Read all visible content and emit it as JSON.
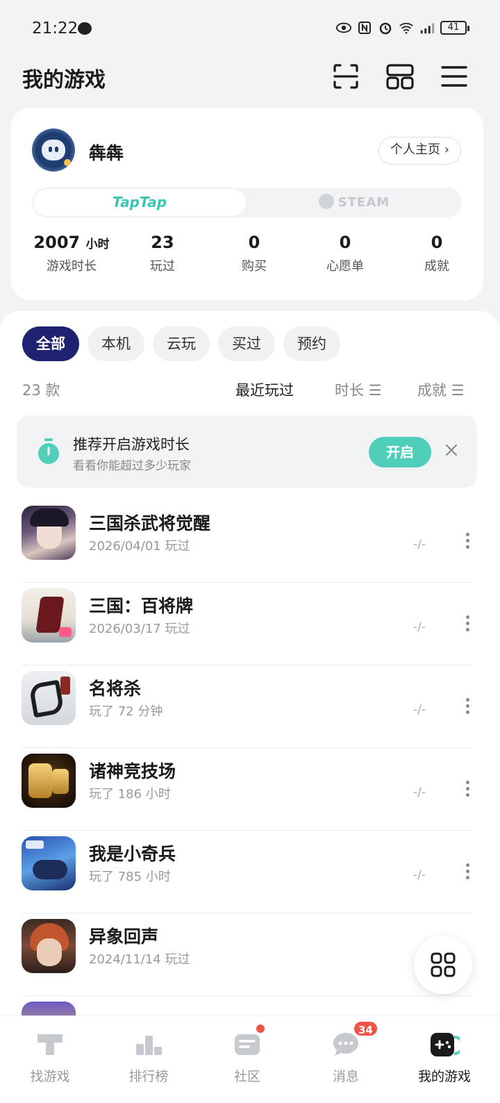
{
  "status_bar": {
    "time": "21:22",
    "battery": "41"
  },
  "header": {
    "title": "我的游戏"
  },
  "profile": {
    "username": "犇犇",
    "home_label": "个人主页",
    "platforms": {
      "active": "TapTap",
      "inactive": "STEAM"
    },
    "stats": [
      {
        "value": "2007",
        "unit": "小时",
        "label": "游戏时长"
      },
      {
        "value": "23",
        "unit": "",
        "label": "玩过"
      },
      {
        "value": "0",
        "unit": "",
        "label": "购买"
      },
      {
        "value": "0",
        "unit": "",
        "label": "心愿单"
      },
      {
        "value": "0",
        "unit": "",
        "label": "成就"
      }
    ]
  },
  "filters": [
    "全部",
    "本机",
    "云玩",
    "买过",
    "预约"
  ],
  "count_label": "23 款",
  "sort": {
    "recent": "最近玩过",
    "duration": "时长",
    "achievement": "成就"
  },
  "banner": {
    "title": "推荐开启游戏时长",
    "subtitle": "看看你能超过多少玩家",
    "button": "开启"
  },
  "games": [
    {
      "name": "三国杀武将觉醒",
      "sub": "2026/04/01 玩过",
      "stat": "-/-"
    },
    {
      "name": "三国：百将牌",
      "sub": "2026/03/17 玩过",
      "stat": "-/-"
    },
    {
      "name": "名将杀",
      "sub": "玩了 72 分钟",
      "stat": "-/-"
    },
    {
      "name": "诸神竞技场",
      "sub": "玩了 186 小时",
      "stat": "-/-"
    },
    {
      "name": "我是小奇兵",
      "sub": "玩了 785 小时",
      "stat": "-/-"
    },
    {
      "name": "异象回声",
      "sub": "2024/11/14 玩过",
      "stat": ""
    }
  ],
  "bottom_nav": {
    "items": [
      {
        "label": "找游戏"
      },
      {
        "label": "排行榜"
      },
      {
        "label": "社区"
      },
      {
        "label": "消息",
        "badge": "34"
      },
      {
        "label": "我的游戏"
      }
    ]
  },
  "colors": {
    "accent": "#1e2270",
    "teal": "#4fcfb9",
    "badge": "#ee5548"
  }
}
